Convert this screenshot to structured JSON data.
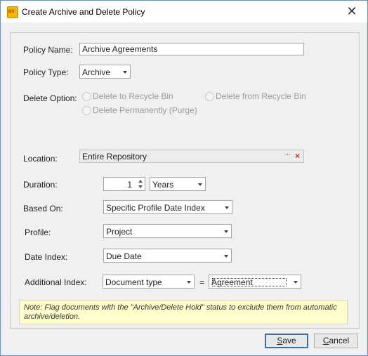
{
  "window": {
    "title": "Create Archive and Delete Policy",
    "icon_text": "DV",
    "close_glyph": "✕"
  },
  "form": {
    "policy_name_label": "Policy Name:",
    "policy_name_value": "Archive Agreements",
    "policy_type_label": "Policy Type:",
    "policy_type_value": "Archive",
    "delete_option_label": "Delete Option:",
    "delete_options": [
      "Delete to Recycle Bin",
      "Delete from Recycle Bin",
      "Delete Permanently (Purge)"
    ],
    "location_label": "Location:",
    "location_value": "Entire Repository",
    "location_browse": "···",
    "location_clear": "×",
    "duration_label": "Duration:",
    "duration_value": "1",
    "duration_unit": "Years",
    "based_on_label": "Based On:",
    "based_on_value": "Specific Profile Date Index",
    "profile_label": "Profile:",
    "profile_value": "Project",
    "date_index_label": "Date Index:",
    "date_index_value": "Due Date",
    "additional_index_label": "Additional Index:",
    "additional_index_field": "Document type",
    "equals": "=",
    "additional_index_value": "Agreement"
  },
  "note": "Note: Flag documents with the \"Archive/Delete Hold\" status to exclude them from automatic archive/deletion.",
  "buttons": {
    "save_first": "S",
    "save_rest": "ave",
    "cancel_first": "C",
    "cancel_rest": "ancel"
  },
  "colors": {
    "window_bg": "#f0f0f0",
    "note_bg": "#ffffcc",
    "clear_red": "#d42020",
    "default_button_border": "#3a6ea5"
  }
}
